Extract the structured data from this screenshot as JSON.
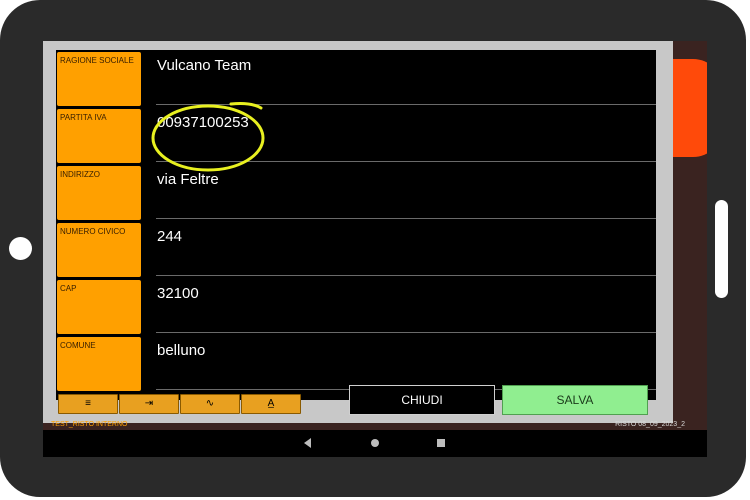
{
  "form": {
    "rows": [
      {
        "label": "RAGIONE SOCIALE",
        "value": "Vulcano Team"
      },
      {
        "label": "PARTITA IVA",
        "value": "00937100253"
      },
      {
        "label": "INDIRIZZO",
        "value": "via Feltre"
      },
      {
        "label": "NUMERO CIVICO",
        "value": "244"
      },
      {
        "label": "CAP",
        "value": "32100"
      },
      {
        "label": "COMUNE",
        "value": "belluno"
      }
    ],
    "highlight": {
      "target": "PARTITA IVA",
      "color": "#e8f020"
    }
  },
  "toolbar": {
    "tools": [
      {
        "icon": "align-center-icon",
        "glyph": "≡"
      },
      {
        "icon": "indent-icon",
        "glyph": "⇥"
      },
      {
        "icon": "wave-icon",
        "glyph": "∿"
      },
      {
        "icon": "text-style-icon",
        "glyph": "A̲"
      }
    ]
  },
  "buttons": {
    "chiudi": "CHIUDI",
    "salva": "SALVA"
  },
  "footer": {
    "left": "TEST_RISTO INTERNO",
    "right": "RISTO 08_09_2023_2"
  },
  "colors": {
    "label_bg": "#ffa000",
    "salva_bg": "#90ee90",
    "accent": "#ff4a0a"
  }
}
